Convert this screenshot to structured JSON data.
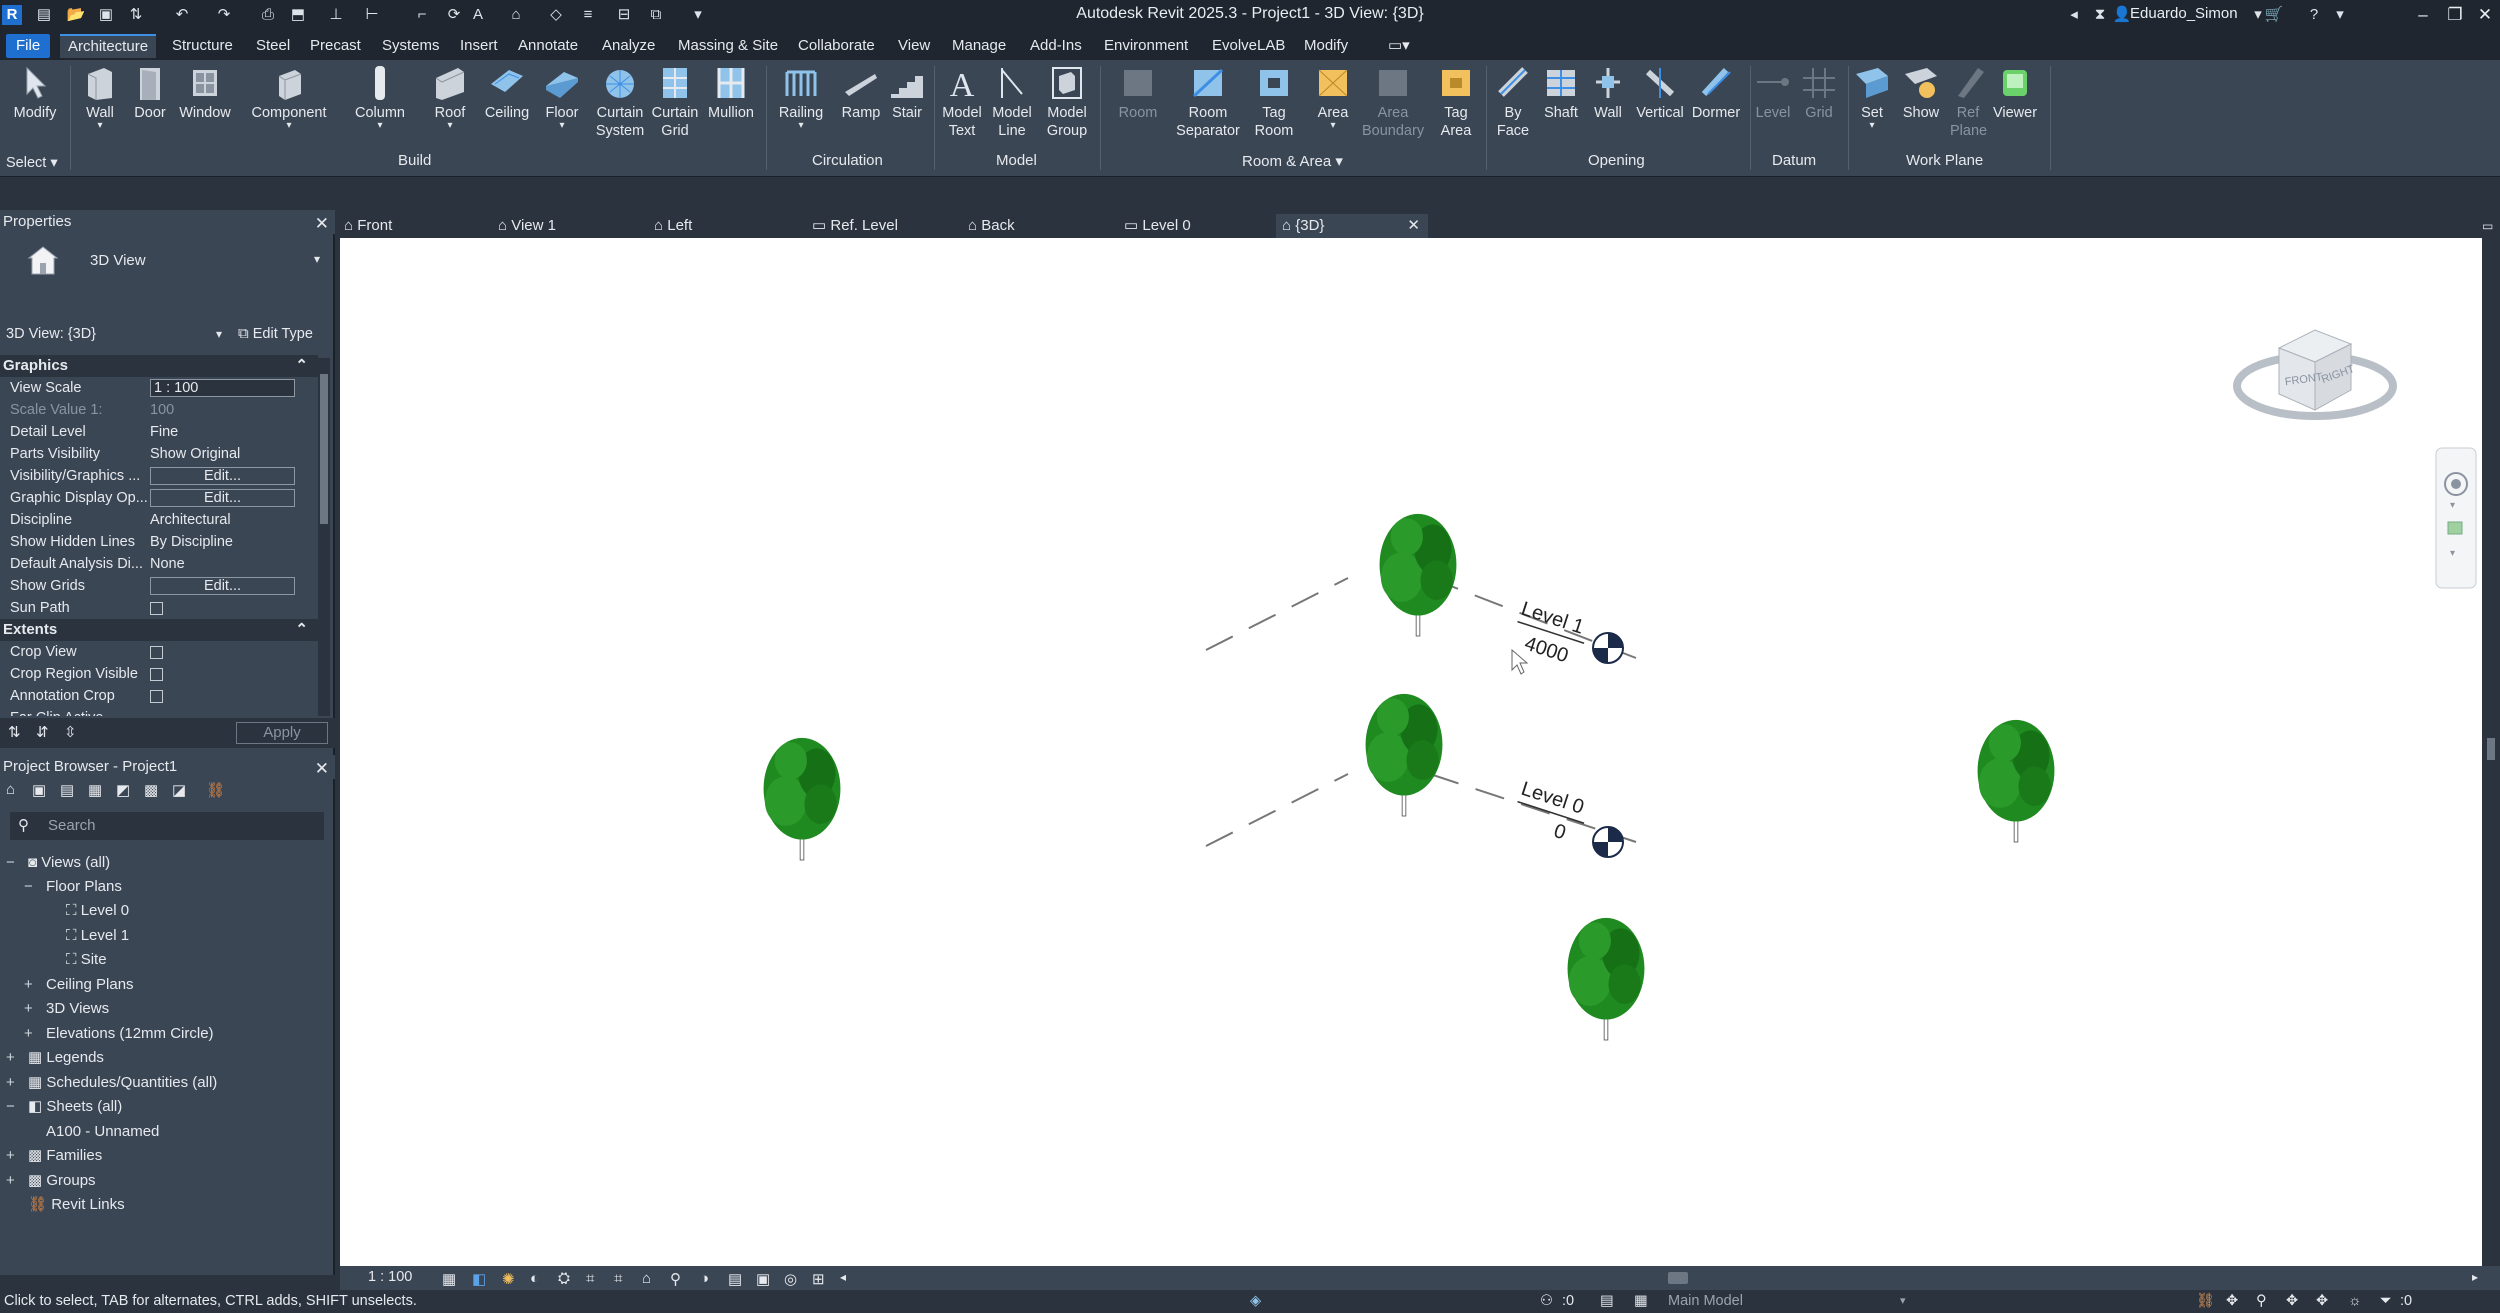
{
  "titlebar": {
    "title": "Autodesk Revit 2025.3 - Project1 - 3D View: {3D}",
    "user": "Eduardo_Simon"
  },
  "ribbon_tabs": [
    "File",
    "Architecture",
    "Structure",
    "Steel",
    "Precast",
    "Systems",
    "Insert",
    "Annotate",
    "Analyze",
    "Massing & Site",
    "Collaborate",
    "View",
    "Manage",
    "Add-Ins",
    "Environment",
    "EvolveLAB",
    "Modify"
  ],
  "ribbon": {
    "select": {
      "modify": "Modify",
      "select_label": "Select"
    },
    "build": {
      "label": "Build",
      "wall": "Wall",
      "door": "Door",
      "window": "Window",
      "component": "Component",
      "column": "Column",
      "roof": "Roof",
      "ceiling": "Ceiling",
      "floor": "Floor",
      "curtain_system_1": "Curtain",
      "curtain_system_2": "System",
      "curtain_grid_1": "Curtain",
      "curtain_grid_2": "Grid",
      "mullion": "Mullion"
    },
    "circulation": {
      "label": "Circulation",
      "railing": "Railing",
      "ramp": "Ramp",
      "stair": "Stair"
    },
    "model": {
      "label": "Model",
      "model_text_1": "Model",
      "model_text_2": "Text",
      "model_line_1": "Model",
      "model_line_2": "Line",
      "model_group_1": "Model",
      "model_group_2": "Group"
    },
    "room_area": {
      "label": "Room & Area",
      "room": "Room",
      "room_sep_1": "Room",
      "room_sep_2": "Separator",
      "tag_room_1": "Tag",
      "tag_room_2": "Room",
      "area": "Area",
      "area_boundary_1": "Area",
      "area_boundary_2": "Boundary",
      "tag_area_1": "Tag",
      "tag_area_2": "Area"
    },
    "opening": {
      "label": "Opening",
      "by_face_1": "By",
      "by_face_2": "Face",
      "shaft": "Shaft",
      "wall": "Wall",
      "vertical": "Vertical",
      "dormer": "Dormer"
    },
    "datum": {
      "label": "Datum",
      "level": "Level",
      "grid": "Grid"
    },
    "work_plane": {
      "label": "Work Plane",
      "set": "Set",
      "show": "Show",
      "ref_plane_1": "Ref",
      "ref_plane_2": "Plane",
      "viewer": "Viewer"
    }
  },
  "properties": {
    "title": "Properties",
    "type_name": "3D View",
    "instance_selector": "3D View: {3D}",
    "edit_type": "Edit Type",
    "sections": {
      "graphics": "Graphics",
      "extents": "Extents"
    },
    "rows": [
      {
        "k": "View Scale",
        "v": "1 : 100"
      },
      {
        "k": "Scale Value    1:",
        "v": "100"
      },
      {
        "k": "Detail Level",
        "v": "Fine"
      },
      {
        "k": "Parts Visibility",
        "v": "Show Original"
      },
      {
        "k": "Visibility/Graphics ...",
        "v": "Edit..."
      },
      {
        "k": "Graphic Display Op...",
        "v": "Edit..."
      },
      {
        "k": "Discipline",
        "v": "Architectural"
      },
      {
        "k": "Show Hidden Lines",
        "v": "By Discipline"
      },
      {
        "k": "Default Analysis Di...",
        "v": "None"
      },
      {
        "k": "Show Grids",
        "v": "Edit..."
      },
      {
        "k": "Sun Path",
        "v": ""
      },
      {
        "k": "Crop View",
        "v": ""
      },
      {
        "k": "Crop Region Visible",
        "v": ""
      },
      {
        "k": "Annotation Crop",
        "v": ""
      },
      {
        "k": "Far Clip Active",
        "v": ""
      }
    ],
    "apply": "Apply"
  },
  "browser": {
    "title": "Project Browser - Project1",
    "search_placeholder": "Search",
    "items": {
      "views_all": "Views (all)",
      "floor_plans": "Floor Plans",
      "level0": "Level 0",
      "level1": "Level 1",
      "site": "Site",
      "ceiling_plans": "Ceiling Plans",
      "views3d": "3D Views",
      "elevations": "Elevations (12mm Circle)",
      "legends": "Legends",
      "schedules": "Schedules/Quantities (all)",
      "sheets": "Sheets (all)",
      "a100": "A100 - Unnamed",
      "families": "Families",
      "groups": "Groups",
      "revit_links": "Revit Links"
    }
  },
  "view_tabs": [
    "Front",
    "View 1",
    "Left",
    "Ref. Level",
    "Back",
    "Level 0",
    "{3D}"
  ],
  "viewport": {
    "level1_name": "Level 1",
    "level1_elev": "4000",
    "level0_name": "Level 0",
    "level0_elev": "0",
    "viewcube_front": "FRONT",
    "viewcube_right": "RIGHT"
  },
  "viewbar": {
    "scale": "1 : 100"
  },
  "status": {
    "hint": "Click to select, TAB for alternates, CTRL adds, SHIFT unselects.",
    "model": "Main Model",
    "count_a": ":0",
    "count_b": ":0"
  },
  "colors": {
    "accent": "#1f6fd1",
    "ribbon": "#3b4655",
    "dark": "#1f2630",
    "tree": "#1f8a1f",
    "level_marker": "#1c2a4a"
  }
}
